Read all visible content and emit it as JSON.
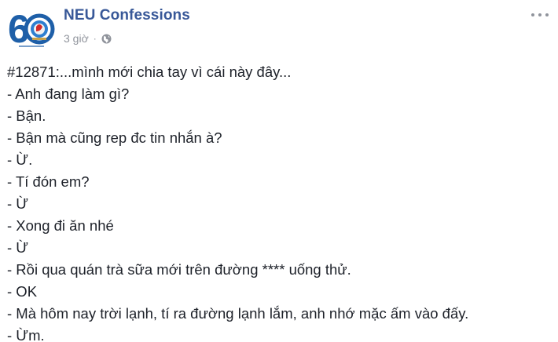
{
  "post": {
    "page_name": "NEU Confessions",
    "timestamp": "3 giờ",
    "separator": "·",
    "audience_icon": "globe-icon",
    "more_icon": "more-options-icon",
    "colors": {
      "page_name": "#385898",
      "meta": "#90949c",
      "text": "#1d2129",
      "avatar_blue": "#1e5fa8"
    },
    "lines": [
      "#12871:...mình mới chia tay vì cái này đây...",
      "- Anh đang làm gì?",
      "- Bận.",
      "- Bận mà cũng rep đc tin nhắn à?",
      "- Ừ.",
      "- Tí đón em?",
      "- Ừ",
      "- Xong đi ăn nhé",
      "- Ừ",
      "- Rồi qua quán trà sữa mới trên đường **** uống thử.",
      "- OK",
      "- Mà hôm nay trời lạnh, tí ra đường lạnh lắm, anh nhớ mặc ấm vào đấy.",
      "- Ừm."
    ]
  }
}
